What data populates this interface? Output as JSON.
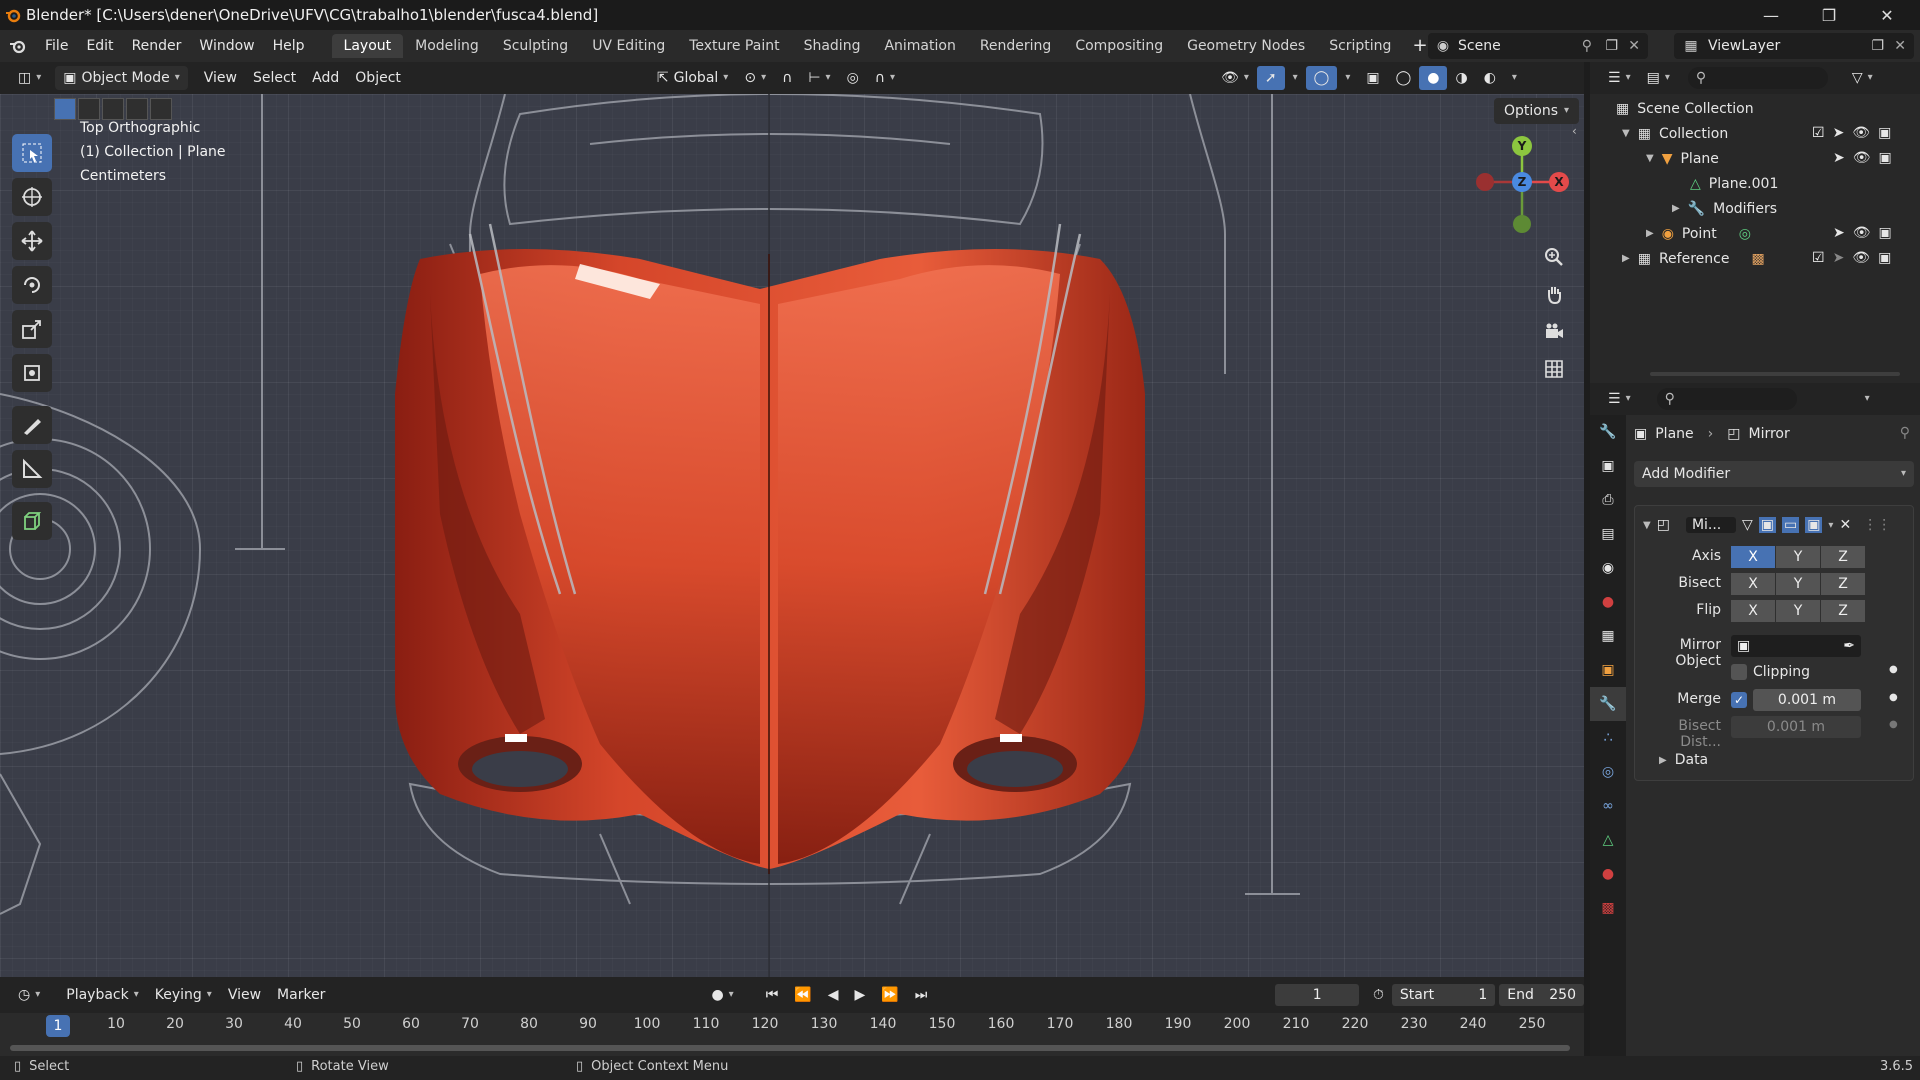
{
  "window": {
    "title": "Blender* [C:\\Users\\dener\\OneDrive\\UFV\\CG\\trabalho1\\blender\\fusca4.blend]"
  },
  "menu": [
    "File",
    "Edit",
    "Render",
    "Window",
    "Help"
  ],
  "workspaces": [
    "Layout",
    "Modeling",
    "Sculpting",
    "UV Editing",
    "Texture Paint",
    "Shading",
    "Animation",
    "Rendering",
    "Compositing",
    "Geometry Nodes",
    "Scripting"
  ],
  "active_workspace": "Layout",
  "scene": "Scene",
  "view_layer": "ViewLayer",
  "viewport_header": {
    "mode": "Object Mode",
    "menus": [
      "View",
      "Select",
      "Add",
      "Object"
    ],
    "orientation": "Global"
  },
  "viewport": {
    "info_lines": [
      "Top Orthographic",
      "(1) Collection | Plane",
      "Centimeters"
    ],
    "options_label": "Options",
    "gizmo": {
      "x": "X",
      "y": "Y",
      "z": "Z"
    }
  },
  "outliner": {
    "rows": [
      {
        "label": "Scene Collection"
      },
      {
        "label": "Collection"
      },
      {
        "label": "Plane"
      },
      {
        "label": "Plane.001"
      },
      {
        "label": "Modifiers"
      },
      {
        "label": "Point"
      },
      {
        "label": "Reference"
      }
    ]
  },
  "properties": {
    "breadcrumb_object": "Plane",
    "breadcrumb_modifier": "Mirror",
    "add_modifier": "Add Modifier",
    "modifier_name": "Mi...",
    "axis_label": "Axis",
    "bisect_label": "Bisect",
    "flip_label": "Flip",
    "axes": [
      "X",
      "Y",
      "Z"
    ],
    "axis_enabled": [
      true,
      false,
      false
    ],
    "mirror_object_label": "Mirror Object",
    "clipping_label": "Clipping",
    "merge_label": "Merge",
    "merge_value": "0.001 m",
    "bisect_dist_label": "Bisect Dist...",
    "bisect_dist_value": "0.001 m",
    "data_label": "Data"
  },
  "timeline": {
    "menus": [
      "Playback",
      "Keying",
      "View",
      "Marker"
    ],
    "current_frame": "1",
    "start_label": "Start",
    "start": "1",
    "end_label": "End",
    "end": "250",
    "ruler": [
      "10",
      "20",
      "30",
      "40",
      "50",
      "60",
      "70",
      "80",
      "90",
      "100",
      "110",
      "120",
      "130",
      "140",
      "150",
      "160",
      "170",
      "180",
      "190",
      "200",
      "210",
      "220",
      "230",
      "240",
      "250"
    ]
  },
  "status": {
    "select": "Select",
    "rotate": "Rotate View",
    "context": "Object Context Menu",
    "version": "3.6.5"
  },
  "colors": {
    "accent": "#4772b3",
    "car_red": "#c8321c",
    "viewport_bg": "#3a3d48"
  }
}
